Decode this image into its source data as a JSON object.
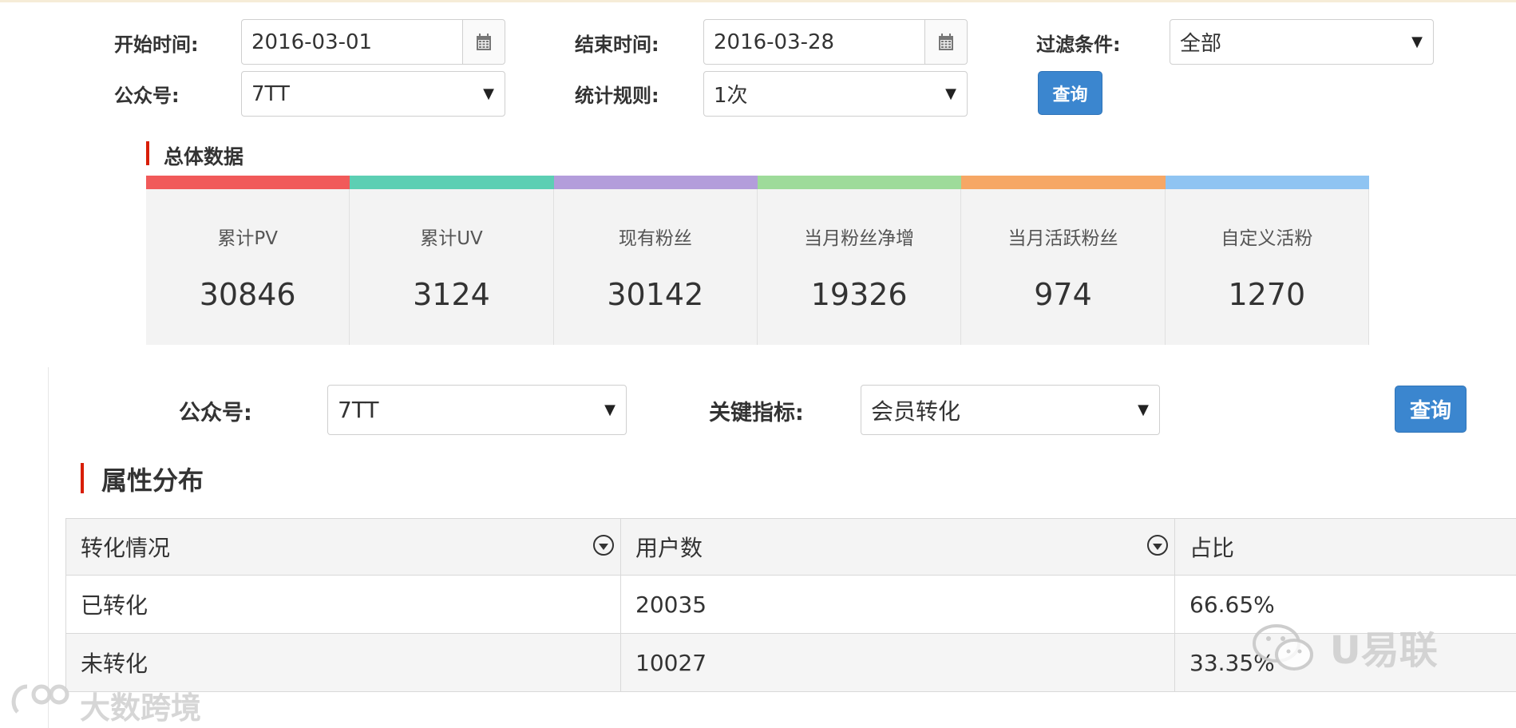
{
  "filters": {
    "start_label": "开始时间:",
    "start_value": "2016-03-01",
    "end_label": "结束时间:",
    "end_value": "2016-03-28",
    "condition_label": "过滤条件:",
    "condition_value": "全部",
    "account_label": "公众号:",
    "account_value": "7TT",
    "rule_label": "统计规则:",
    "rule_value": "1次",
    "query_label": "查询"
  },
  "overview": {
    "title": "总体数据",
    "cards": [
      {
        "label": "累计PV",
        "value": "30846",
        "color": "#f15a5a"
      },
      {
        "label": "累计UV",
        "value": "3124",
        "color": "#5ccfb3"
      },
      {
        "label": "现有粉丝",
        "value": "30142",
        "color": "#b39ddb"
      },
      {
        "label": "当月粉丝净增",
        "value": "19326",
        "color": "#9edb9a"
      },
      {
        "label": "当月活跃粉丝",
        "value": "974",
        "color": "#f6a765"
      },
      {
        "label": "自定义活粉",
        "value": "1270",
        "color": "#8fc4f2"
      }
    ]
  },
  "attr_filters": {
    "account_label": "公众号:",
    "account_value": "7TT",
    "metric_label": "关键指标:",
    "metric_value": "会员转化",
    "query_label": "查询"
  },
  "distribution": {
    "title": "属性分布",
    "columns": [
      "转化情况",
      "用户数",
      "占比"
    ],
    "rows": [
      [
        "已转化",
        "20035",
        "66.65%"
      ],
      [
        "未转化",
        "10027",
        "33.35%"
      ]
    ]
  },
  "watermarks": {
    "right": "U易联",
    "left": "大数跨境"
  }
}
